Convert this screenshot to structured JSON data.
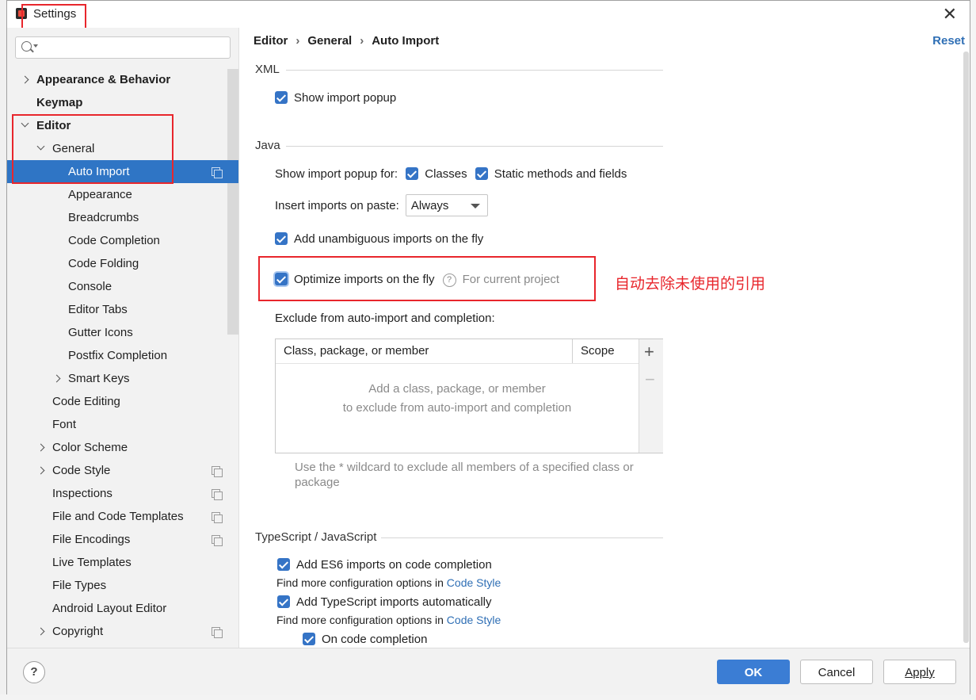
{
  "dialog": {
    "title": "Settings"
  },
  "search": {
    "placeholder": ""
  },
  "tree": [
    {
      "label": "Appearance & Behavior",
      "bold": true
    },
    {
      "label": "Keymap",
      "bold": true
    },
    {
      "label": "Editor",
      "bold": true
    },
    {
      "label": "General"
    },
    {
      "label": "Auto Import",
      "selected": true
    },
    {
      "label": "Appearance"
    },
    {
      "label": "Breadcrumbs"
    },
    {
      "label": "Code Completion"
    },
    {
      "label": "Code Folding"
    },
    {
      "label": "Console"
    },
    {
      "label": "Editor Tabs"
    },
    {
      "label": "Gutter Icons"
    },
    {
      "label": "Postfix Completion"
    },
    {
      "label": "Smart Keys"
    },
    {
      "label": "Code Editing"
    },
    {
      "label": "Font"
    },
    {
      "label": "Color Scheme"
    },
    {
      "label": "Code Style"
    },
    {
      "label": "Inspections"
    },
    {
      "label": "File and Code Templates"
    },
    {
      "label": "File Encodings"
    },
    {
      "label": "Live Templates"
    },
    {
      "label": "File Types"
    },
    {
      "label": "Android Layout Editor"
    },
    {
      "label": "Copyright"
    }
  ],
  "breadcrumb": {
    "editor": "Editor",
    "general": "General",
    "current": "Auto Import",
    "separator": "›"
  },
  "reset_label": "Reset",
  "xml": {
    "title": "XML",
    "show_popup": "Show import popup"
  },
  "java": {
    "title": "Java",
    "popup_for": "Show import popup for:",
    "classes": "Classes",
    "static_methods": "Static methods and fields",
    "insert_on_paste": "Insert imports on paste:",
    "insert_value": "Always",
    "add_unambiguous": "Add unambiguous imports on the fly",
    "optimize": "Optimize imports on the fly",
    "for_current_project": "For current project",
    "exclude_title": "Exclude from auto-import and completion:",
    "table": {
      "col_class": "Class, package, or member",
      "col_scope": "Scope",
      "empty_line1": "Add a class, package, or member",
      "empty_line2": "to exclude from auto-import and completion"
    },
    "hint_line1": "Use the * wildcard to exclude all members of a specified class or",
    "hint_line2": "package"
  },
  "annotation": "自动去除未使用的引用",
  "ts": {
    "title": "TypeScript / JavaScript",
    "es6": "Add ES6 imports on code completion",
    "more_config": "Find more configuration options in",
    "code_style_link": "Code Style",
    "ts_auto": "Add TypeScript imports automatically",
    "on_completion": "On code completion"
  },
  "buttons": {
    "ok": "OK",
    "cancel": "Cancel",
    "apply": "Apply",
    "help": "?"
  },
  "colors": {
    "accent": "#3b7dd4",
    "selection": "#2f75c5",
    "annotation": "#e8262c",
    "link": "#2f6fb5"
  }
}
